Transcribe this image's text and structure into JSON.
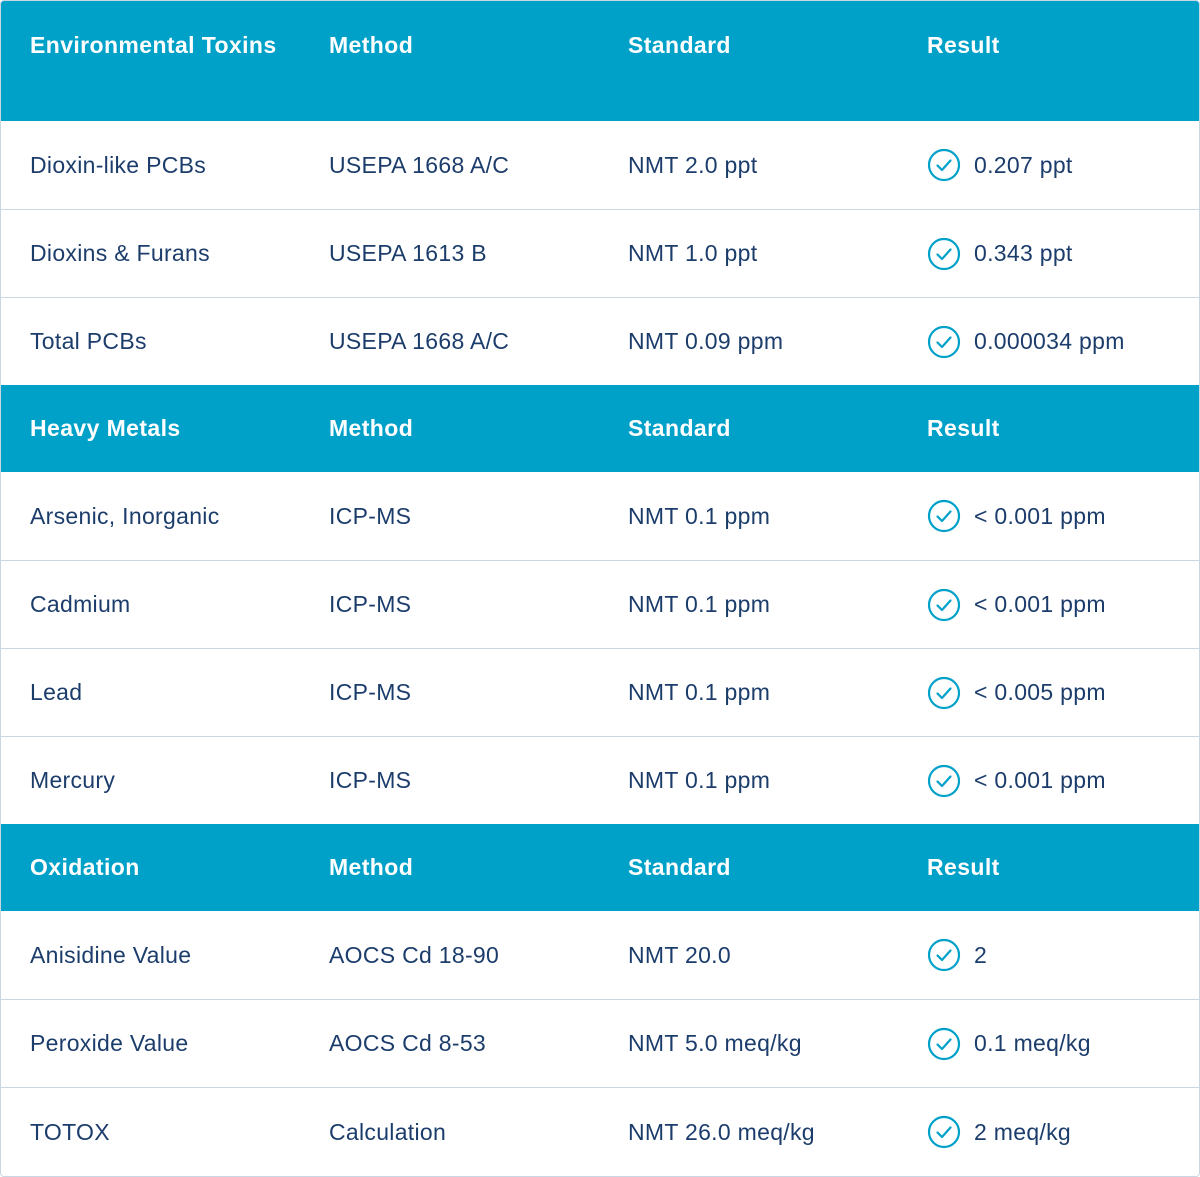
{
  "colors": {
    "header_bg": "#00a1c9",
    "text": "#1c3d6b",
    "border": "#c9d6e3",
    "check": "#00a1c9"
  },
  "icons": {
    "result_status": "check-circle-icon"
  },
  "sections": [
    {
      "header": [
        "Environmental Toxins",
        "Method",
        "Standard",
        "Result"
      ],
      "rows": [
        [
          "Dioxin-like PCBs",
          "USEPA 1668 A/C",
          "NMT 2.0 ppt",
          "0.207 ppt"
        ],
        [
          "Dioxins & Furans",
          "USEPA 1613 B",
          "NMT 1.0 ppt",
          "0.343 ppt"
        ],
        [
          "Total PCBs",
          "USEPA 1668 A/C",
          "NMT 0.09 ppm",
          "0.000034 ppm"
        ]
      ]
    },
    {
      "header": [
        "Heavy Metals",
        "Method",
        "Standard",
        "Result"
      ],
      "rows": [
        [
          "Arsenic, Inorganic",
          "ICP-MS",
          "NMT 0.1 ppm",
          "< 0.001 ppm"
        ],
        [
          "Cadmium",
          "ICP-MS",
          "NMT 0.1 ppm",
          "< 0.001 ppm"
        ],
        [
          "Lead",
          "ICP-MS",
          "NMT 0.1 ppm",
          "< 0.005 ppm"
        ],
        [
          "Mercury",
          "ICP-MS",
          "NMT 0.1 ppm",
          "< 0.001 ppm"
        ]
      ]
    },
    {
      "header": [
        "Oxidation",
        "Method",
        "Standard",
        "Result"
      ],
      "rows": [
        [
          "Anisidine Value",
          "AOCS Cd 18-90",
          "NMT 20.0",
          "2"
        ],
        [
          "Peroxide Value",
          "AOCS Cd 8-53",
          "NMT 5.0 meq/kg",
          "0.1 meq/kg"
        ],
        [
          "TOTOX",
          "Calculation",
          "NMT 26.0 meq/kg",
          "2 meq/kg"
        ]
      ]
    }
  ]
}
